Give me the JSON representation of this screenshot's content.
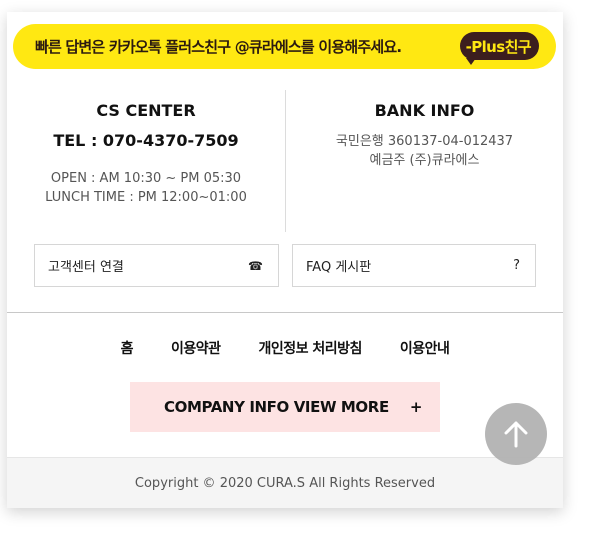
{
  "kakao": {
    "message": "빠른 답변은 카카오톡 플러스친구 @큐라에스를 이용해주세요.",
    "badge_label": "-Plus친구",
    "color": "#ffe812"
  },
  "cs_center": {
    "title": "CS CENTER",
    "tel": "TEL : 070-4370-7509",
    "open_hours": "OPEN : AM 10:30 ~ PM 05:30",
    "lunch_time": "LUNCH TIME : PM 12:00~01:00"
  },
  "bank_info": {
    "title": "BANK INFO",
    "account": "국민은행 360137-04-012437",
    "holder": "예금주 (주)큐라에스"
  },
  "links": {
    "cs_connect_label": "고객센터 연결",
    "cs_connect_icon": "phone-icon",
    "cs_connect_glyph": "☎",
    "faq_label": "FAQ 게시판",
    "faq_icon": "question-icon",
    "faq_glyph": "?"
  },
  "footer_nav": {
    "items": [
      "홈",
      "이용약관",
      "개인정보 처리방침",
      "이용안내"
    ]
  },
  "more_button": {
    "label": "COMPANY INFO VIEW MORE",
    "plus": "+",
    "color": "#fde3e3"
  },
  "copyright": "Copyright © 2020 CURA.S All Rights Reserved",
  "scroll_top": {
    "icon": "arrow-up-icon"
  }
}
